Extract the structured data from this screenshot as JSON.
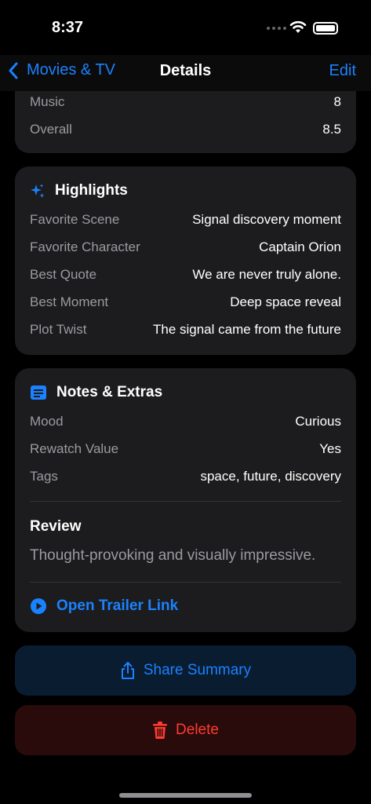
{
  "status": {
    "time": "8:37"
  },
  "nav": {
    "back_label": "Movies & TV",
    "title": "Details",
    "edit_label": "Edit"
  },
  "ratings": [
    {
      "label": "Music",
      "value": "8"
    },
    {
      "label": "Overall",
      "value": "8.5"
    }
  ],
  "highlights": {
    "title": "Highlights",
    "rows": [
      {
        "label": "Favorite Scene",
        "value": "Signal discovery moment"
      },
      {
        "label": "Favorite Character",
        "value": "Captain Orion"
      },
      {
        "label": "Best Quote",
        "value": "We are never truly alone."
      },
      {
        "label": "Best Moment",
        "value": "Deep space reveal"
      },
      {
        "label": "Plot Twist",
        "value": "The signal came from the future"
      }
    ]
  },
  "notes": {
    "title": "Notes & Extras",
    "rows": [
      {
        "label": "Mood",
        "value": "Curious"
      },
      {
        "label": "Rewatch Value",
        "value": "Yes"
      },
      {
        "label": "Tags",
        "value": "space, future, discovery"
      }
    ],
    "review_heading": "Review",
    "review_text": "Thought-provoking and visually impressive.",
    "trailer_link": "Open Trailer Link"
  },
  "actions": {
    "share_label": "Share Summary",
    "delete_label": "Delete"
  },
  "colors": {
    "accent": "#1a82ff",
    "destructive": "#ff3b30",
    "card": "#1c1c1e"
  }
}
